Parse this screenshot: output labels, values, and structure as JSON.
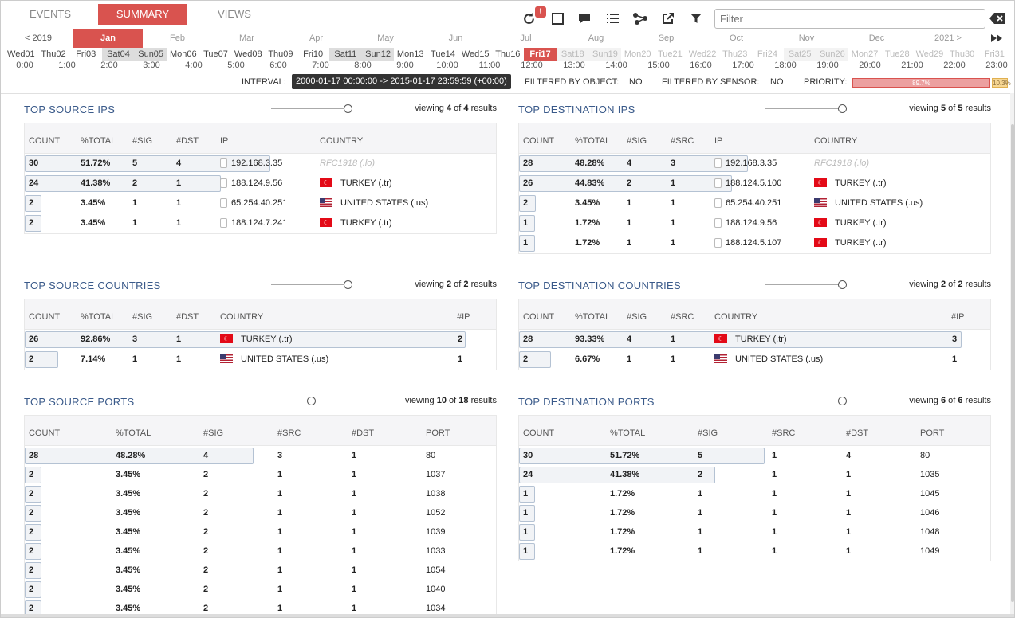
{
  "tabs": [
    "EVENTS",
    "SUMMARY",
    "VIEWS"
  ],
  "toolbar": {
    "badge": "!",
    "filter_placeholder": "Filter"
  },
  "months": {
    "prev": "< 2019",
    "items": [
      "Jan",
      "Feb",
      "Mar",
      "Apr",
      "May",
      "Jun",
      "Jul",
      "Aug",
      "Sep",
      "Oct",
      "Nov",
      "Dec"
    ],
    "next": "2021 >"
  },
  "days": [
    "Wed01",
    "Thu02",
    "Fri03",
    "Sat04",
    "Sun05",
    "Mon06",
    "Tue07",
    "Wed08",
    "Thu09",
    "Fri10",
    "Sat11",
    "Sun12",
    "Mon13",
    "Tue14",
    "Wed15",
    "Thu16",
    "Fri17",
    "Sat18",
    "Sun19",
    "Mon20",
    "Tue21",
    "Wed22",
    "Thu23",
    "Fri24",
    "Sat25",
    "Sun26",
    "Mon27",
    "Tue28",
    "Wed29",
    "Thu30",
    "Fri31"
  ],
  "hours": [
    "0:00",
    "1:00",
    "2:00",
    "3:00",
    "4:00",
    "5:00",
    "6:00",
    "7:00",
    "8:00",
    "9:00",
    "10:00",
    "11:00",
    "12:00",
    "13:00",
    "14:00",
    "15:00",
    "16:00",
    "17:00",
    "18:00",
    "19:00",
    "20:00",
    "21:00",
    "22:00",
    "23:00"
  ],
  "status": {
    "interval_label": "INTERVAL:",
    "interval_value": "2000-01-17 00:00:00 -> 2015-01-17 23:59:59 (+00:00)",
    "filtered_object_label": "FILTERED BY OBJECT:",
    "filtered_object_value": "NO",
    "filtered_sensor_label": "FILTERED BY SENSOR:",
    "filtered_sensor_value": "NO",
    "priority_label": "PRIORITY:",
    "priority_high": "89.7%",
    "priority_low": "10.3%",
    "priority_high_fraction": 0.897
  },
  "sections": {
    "src_ips": {
      "title": "TOP SOURCE IPS",
      "viewing": {
        "prefix": "viewing ",
        "shown": "4",
        "mid": " of ",
        "total": "4",
        "suffix": " results"
      },
      "headers": [
        "COUNT",
        "%TOTAL",
        "#SIG",
        "#DST",
        "IP",
        "COUNTRY"
      ],
      "rows": [
        {
          "count": "30",
          "pct": "51.72%",
          "sig": "5",
          "dst": "4",
          "ip": "192.168.3.35",
          "country": "RFC1918 (.lo)",
          "flag": "",
          "fill": 0.5172
        },
        {
          "count": "24",
          "pct": "41.38%",
          "sig": "2",
          "dst": "1",
          "ip": "188.124.9.56",
          "country": "TURKEY (.tr)",
          "flag": "tr",
          "fill": 0.4138
        },
        {
          "count": "2",
          "pct": "3.45%",
          "sig": "1",
          "dst": "1",
          "ip": "65.254.40.251",
          "country": "UNITED STATES (.us)",
          "flag": "us",
          "fill": 0.0345
        },
        {
          "count": "2",
          "pct": "3.45%",
          "sig": "1",
          "dst": "1",
          "ip": "188.124.7.241",
          "country": "TURKEY (.tr)",
          "flag": "tr",
          "fill": 0.0345
        }
      ]
    },
    "dst_ips": {
      "title": "TOP DESTINATION IPS",
      "viewing": {
        "prefix": "viewing ",
        "shown": "5",
        "mid": " of ",
        "total": "5",
        "suffix": " results"
      },
      "headers": [
        "COUNT",
        "%TOTAL",
        "#SIG",
        "#SRC",
        "IP",
        "COUNTRY"
      ],
      "rows": [
        {
          "count": "28",
          "pct": "48.28%",
          "sig": "4",
          "dst": "3",
          "ip": "192.168.3.35",
          "country": "RFC1918 (.lo)",
          "flag": "",
          "fill": 0.4828
        },
        {
          "count": "26",
          "pct": "44.83%",
          "sig": "2",
          "dst": "1",
          "ip": "188.124.5.100",
          "country": "TURKEY (.tr)",
          "flag": "tr",
          "fill": 0.4483
        },
        {
          "count": "2",
          "pct": "3.45%",
          "sig": "1",
          "dst": "1",
          "ip": "65.254.40.251",
          "country": "UNITED STATES (.us)",
          "flag": "us",
          "fill": 0.0345
        },
        {
          "count": "1",
          "pct": "1.72%",
          "sig": "1",
          "dst": "1",
          "ip": "188.124.9.56",
          "country": "TURKEY (.tr)",
          "flag": "tr",
          "fill": 0.0172
        },
        {
          "count": "1",
          "pct": "1.72%",
          "sig": "1",
          "dst": "1",
          "ip": "188.124.5.107",
          "country": "TURKEY (.tr)",
          "flag": "tr",
          "fill": 0.0172
        }
      ]
    },
    "src_countries": {
      "title": "TOP SOURCE COUNTRIES",
      "viewing": {
        "prefix": "viewing ",
        "shown": "2",
        "mid": " of ",
        "total": "2",
        "suffix": " results"
      },
      "headers": [
        "COUNT",
        "%TOTAL",
        "#SIG",
        "#DST",
        "COUNTRY",
        "#IP"
      ],
      "rows": [
        {
          "count": "26",
          "pct": "92.86%",
          "sig": "3",
          "dst": "1",
          "country": "TURKEY (.tr)",
          "flag": "tr",
          "ip": "2",
          "fill": 0.9286
        },
        {
          "count": "2",
          "pct": "7.14%",
          "sig": "1",
          "dst": "1",
          "country": "UNITED STATES (.us)",
          "flag": "us",
          "ip": "1",
          "fill": 0.0714
        }
      ]
    },
    "dst_countries": {
      "title": "TOP DESTINATION COUNTRIES",
      "viewing": {
        "prefix": "viewing ",
        "shown": "2",
        "mid": " of ",
        "total": "2",
        "suffix": " results"
      },
      "headers": [
        "COUNT",
        "%TOTAL",
        "#SIG",
        "#SRC",
        "COUNTRY",
        "#IP"
      ],
      "rows": [
        {
          "count": "28",
          "pct": "93.33%",
          "sig": "4",
          "dst": "1",
          "country": "TURKEY (.tr)",
          "flag": "tr",
          "ip": "3",
          "fill": 0.9333
        },
        {
          "count": "2",
          "pct": "6.67%",
          "sig": "1",
          "dst": "1",
          "country": "UNITED STATES (.us)",
          "flag": "us",
          "ip": "1",
          "fill": 0.0667
        }
      ]
    },
    "src_ports": {
      "title": "TOP SOURCE PORTS",
      "viewing": {
        "prefix": "viewing ",
        "shown": "10",
        "mid": " of ",
        "total": "18",
        "suffix": " results"
      },
      "headers": [
        "COUNT",
        "%TOTAL",
        "#SIG",
        "#SRC",
        "#DST",
        "PORT"
      ],
      "rows": [
        {
          "count": "28",
          "pct": "48.28%",
          "sig": "4",
          "src": "3",
          "dst": "1",
          "port": "80",
          "fill": 0.4828
        },
        {
          "count": "2",
          "pct": "3.45%",
          "sig": "2",
          "src": "1",
          "dst": "1",
          "port": "1037",
          "fill": 0.0345
        },
        {
          "count": "2",
          "pct": "3.45%",
          "sig": "2",
          "src": "1",
          "dst": "1",
          "port": "1038",
          "fill": 0.0345
        },
        {
          "count": "2",
          "pct": "3.45%",
          "sig": "2",
          "src": "1",
          "dst": "1",
          "port": "1052",
          "fill": 0.0345
        },
        {
          "count": "2",
          "pct": "3.45%",
          "sig": "2",
          "src": "1",
          "dst": "1",
          "port": "1039",
          "fill": 0.0345
        },
        {
          "count": "2",
          "pct": "3.45%",
          "sig": "2",
          "src": "1",
          "dst": "1",
          "port": "1033",
          "fill": 0.0345
        },
        {
          "count": "2",
          "pct": "3.45%",
          "sig": "2",
          "src": "1",
          "dst": "1",
          "port": "1054",
          "fill": 0.0345
        },
        {
          "count": "2",
          "pct": "3.45%",
          "sig": "2",
          "src": "1",
          "dst": "1",
          "port": "1040",
          "fill": 0.0345
        },
        {
          "count": "2",
          "pct": "3.45%",
          "sig": "2",
          "src": "1",
          "dst": "1",
          "port": "1034",
          "fill": 0.0345
        }
      ]
    },
    "dst_ports": {
      "title": "TOP DESTINATION PORTS",
      "viewing": {
        "prefix": "viewing ",
        "shown": "6",
        "mid": " of ",
        "total": "6",
        "suffix": " results"
      },
      "headers": [
        "COUNT",
        "%TOTAL",
        "#SIG",
        "#SRC",
        "#DST",
        "PORT"
      ],
      "rows": [
        {
          "count": "30",
          "pct": "51.72%",
          "sig": "5",
          "src": "1",
          "dst": "4",
          "port": "80",
          "fill": 0.5172
        },
        {
          "count": "24",
          "pct": "41.38%",
          "sig": "2",
          "src": "1",
          "dst": "1",
          "port": "1035",
          "fill": 0.4138
        },
        {
          "count": "1",
          "pct": "1.72%",
          "sig": "1",
          "src": "1",
          "dst": "1",
          "port": "1045",
          "fill": 0.0172
        },
        {
          "count": "1",
          "pct": "1.72%",
          "sig": "1",
          "src": "1",
          "dst": "1",
          "port": "1046",
          "fill": 0.0172
        },
        {
          "count": "1",
          "pct": "1.72%",
          "sig": "1",
          "src": "1",
          "dst": "1",
          "port": "1048",
          "fill": 0.0172
        },
        {
          "count": "1",
          "pct": "1.72%",
          "sig": "1",
          "src": "1",
          "dst": "1",
          "port": "1049",
          "fill": 0.0172
        }
      ]
    }
  },
  "colors": {
    "accent": "#d9534f",
    "title_blue": "#3a5a8a",
    "bar_border": "#b4c2d3",
    "priority_low": "#f0c674"
  },
  "icons": [
    "refresh-icon",
    "fullscreen-icon",
    "comment-icon",
    "list-icon",
    "graph-icon",
    "export-icon",
    "filter-icon",
    "clear-filter-icon",
    "fast-forward-icon"
  ]
}
